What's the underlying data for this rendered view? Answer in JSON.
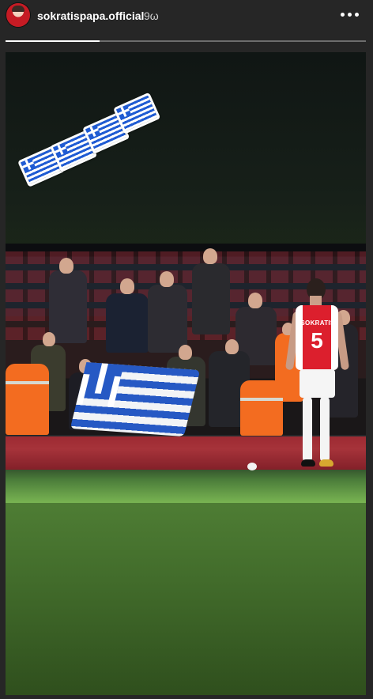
{
  "story": {
    "username": "sokratispapa.official",
    "time_ago": "9ω",
    "progress_fraction": 0.26,
    "menu_icon": "more-horizontal-icon",
    "player_shirt_name": "SOKRATIS",
    "player_shirt_number": "5"
  },
  "colors": {
    "background": "#262626",
    "text_primary": "#ffffff",
    "text_secondary": "#cfcfcf",
    "progress_track": "#6d6d6d",
    "progress_fill": "#ffffff",
    "greek_blue": "#1f5bd3",
    "arsenal_red": "#dc1f2d",
    "pitch_green": "#4b7c3a"
  }
}
